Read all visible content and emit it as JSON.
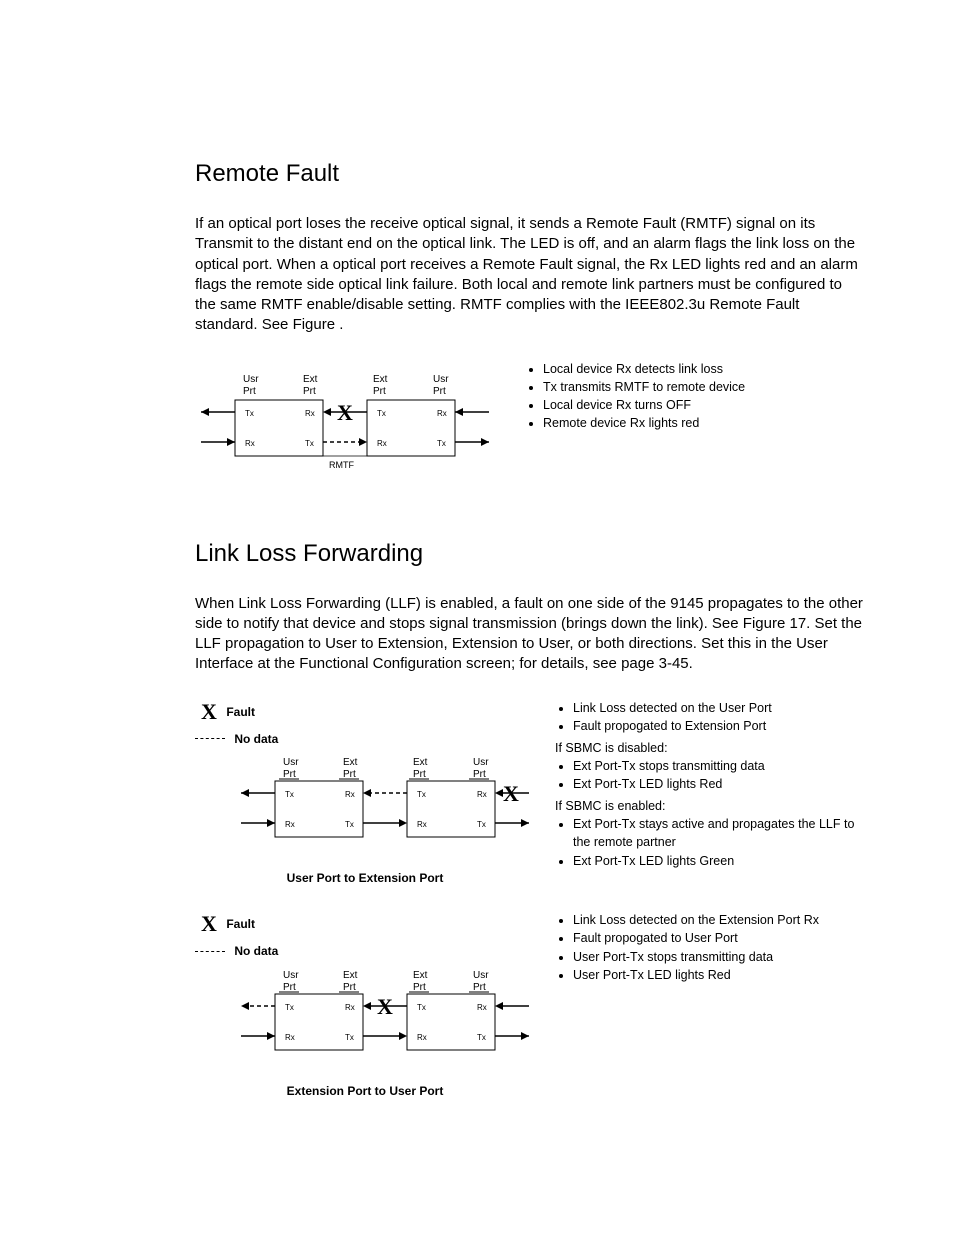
{
  "section1": {
    "title": "Remote Fault",
    "paragraph": "If an optical port loses the receive optical signal, it sends a Remote Fault (RMTF) signal on its Transmit to the distant end on the optical link.  The      LED is off, and an alarm flags the link loss on the optical port.  When a optical port receives a Remote Fault signal, the Rx LED lights red and an alarm flags the remote side optical link failure.  Both local and remote link partners must be configured to the same RMTF enable/disable setting.  RMTF complies with the IEEE802.3u Remote Fault standard.  See Figure     .",
    "diagram": {
      "labels": {
        "usrPrt": "Usr\nPrt",
        "extPrt": "Ext\nPrt",
        "tx": "Tx",
        "rx": "Rx",
        "mid": "RMTF"
      }
    },
    "notes": [
      "Local device Rx detects link loss",
      "Tx transmits RMTF to remote device",
      "Local device Rx turns OFF",
      "Remote device Rx lights red"
    ]
  },
  "section2": {
    "title": "Link Loss Forwarding",
    "paragraph": "When Link Loss Forwarding (LLF) is enabled, a fault on one side of the 9145 propagates to the other side to notify that device and stops signal transmission (brings down the link).  See Figure 17.  Set the LLF propagation to User to Extension, Extension to User, or both directions.  Set this in the User Interface at the Functional Configuration screen; for details, see page 3-45.",
    "legend": {
      "fault": "Fault",
      "nodata": "No data"
    },
    "diagramA": {
      "caption": "User Port to Extension Port",
      "notes_pre": [
        "Link Loss detected on the User Port",
        "Fault propogated to Extension Port"
      ],
      "group1_label": "If SBMC is disabled:",
      "group1_notes": [
        "Ext Port-Tx stops transmitting data",
        "Ext Port-Tx LED lights Red"
      ],
      "group2_label": "If SBMC is enabled:",
      "group2_notes": [
        "Ext Port-Tx stays active and propagates the LLF to the remote partner",
        "Ext Port-Tx LED lights Green"
      ]
    },
    "diagramB": {
      "caption": "Extension Port to User Port",
      "notes": [
        "Link Loss detected on the Extension Port Rx",
        "Fault propogated to User Port",
        "User Port-Tx stops transmitting data",
        "User Port-Tx LED lights Red"
      ]
    }
  }
}
